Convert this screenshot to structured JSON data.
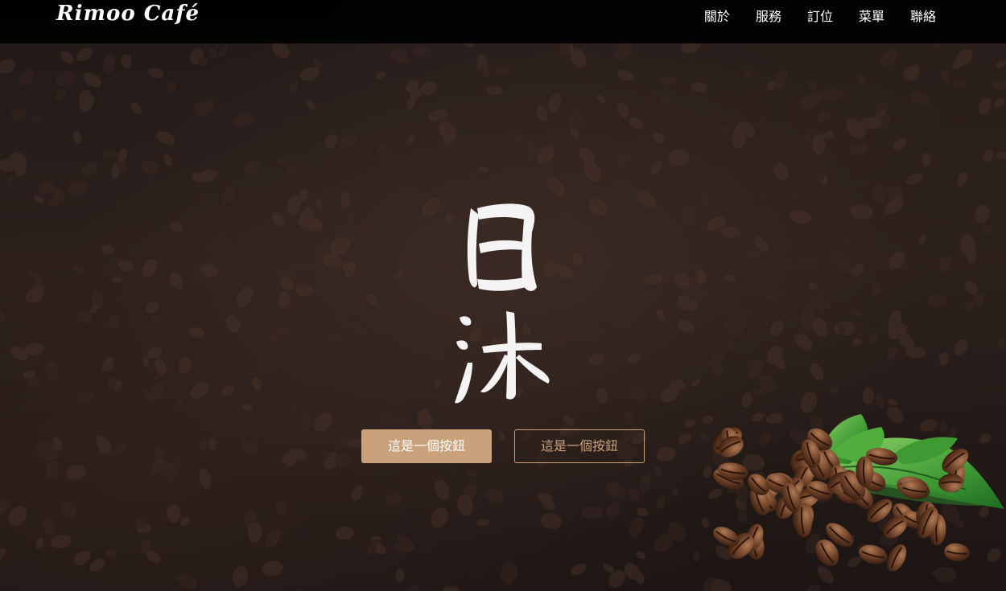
{
  "header": {
    "logo_text": "Rimoo Café",
    "nav_items": [
      "關於",
      "服務",
      "訂位",
      "菜單",
      "聯絡"
    ]
  },
  "hero": {
    "title_calligraphy": "日沐",
    "primary_button": "這是一個按鈕",
    "secondary_button": "這是一個按鈕"
  },
  "colors": {
    "navbar_bg": "#000000",
    "accent": "#c9a27c",
    "text_light": "#ffffff",
    "background_dark": "#1a1513"
  },
  "icons": [
    "coffee-beans-leaf-illustration",
    "calligraphy-title-image"
  ]
}
